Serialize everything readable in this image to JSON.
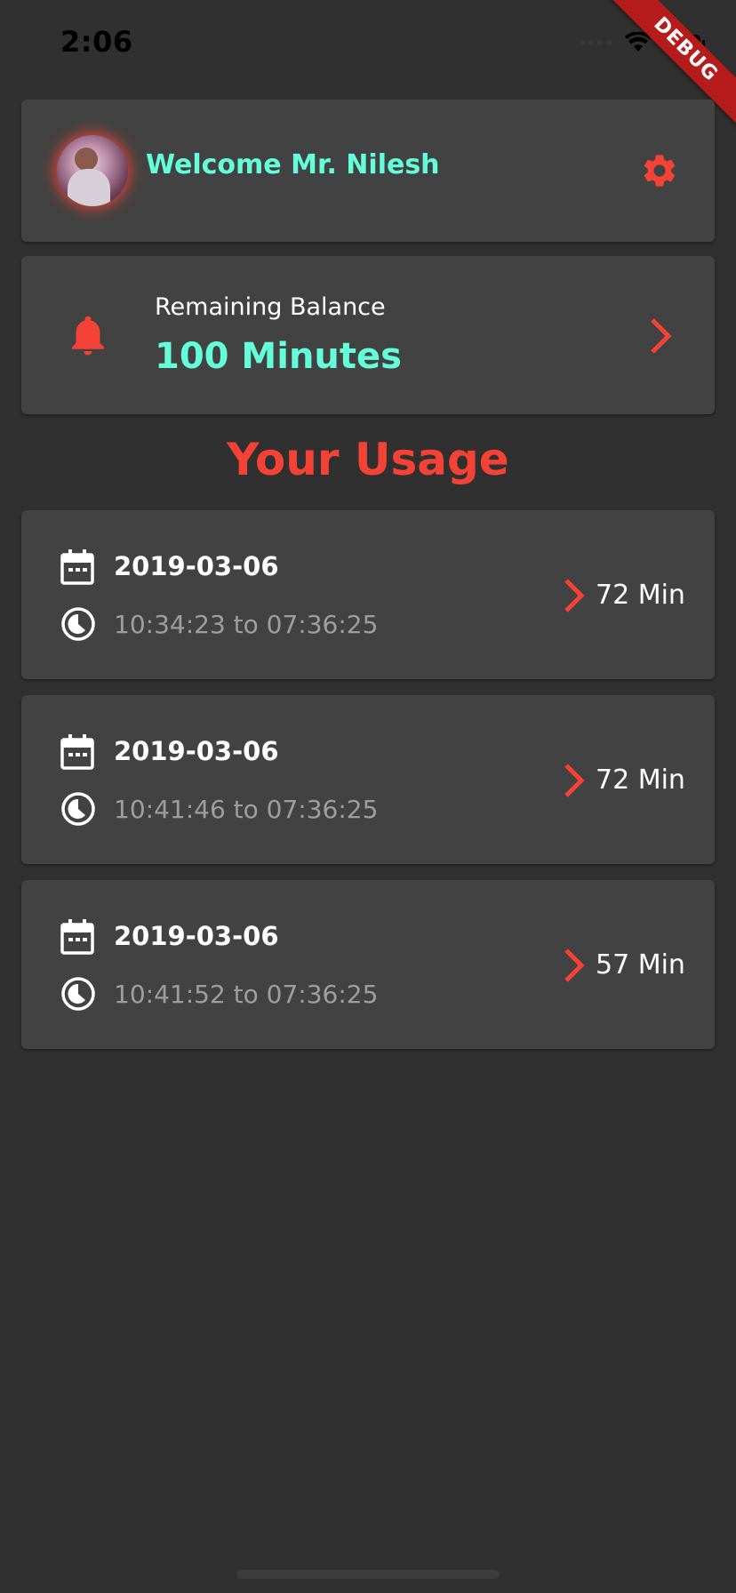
{
  "status_bar": {
    "time": "2:06",
    "debug_label": "DEBUG"
  },
  "header": {
    "welcome_text": "Welcome Mr. Nilesh",
    "avatar_icon": "avatar",
    "settings_icon": "gear-icon"
  },
  "balance": {
    "label": "Remaining Balance",
    "value": "100 Minutes",
    "icon": "bell-icon"
  },
  "usage": {
    "title": "Your Usage",
    "items": [
      {
        "date": "2019-03-06",
        "time_range": "10:34:23 to 07:36:25",
        "duration": "72 Min"
      },
      {
        "date": "2019-03-06",
        "time_range": "10:41:46 to 07:36:25",
        "duration": "72 Min"
      },
      {
        "date": "2019-03-06",
        "time_range": "10:41:52 to 07:36:25",
        "duration": "57 Min"
      }
    ]
  },
  "colors": {
    "background": "#303030",
    "card": "#424242",
    "accent_teal": "#64ffda",
    "accent_red": "#f44336",
    "muted_text": "#9e9e9e"
  }
}
